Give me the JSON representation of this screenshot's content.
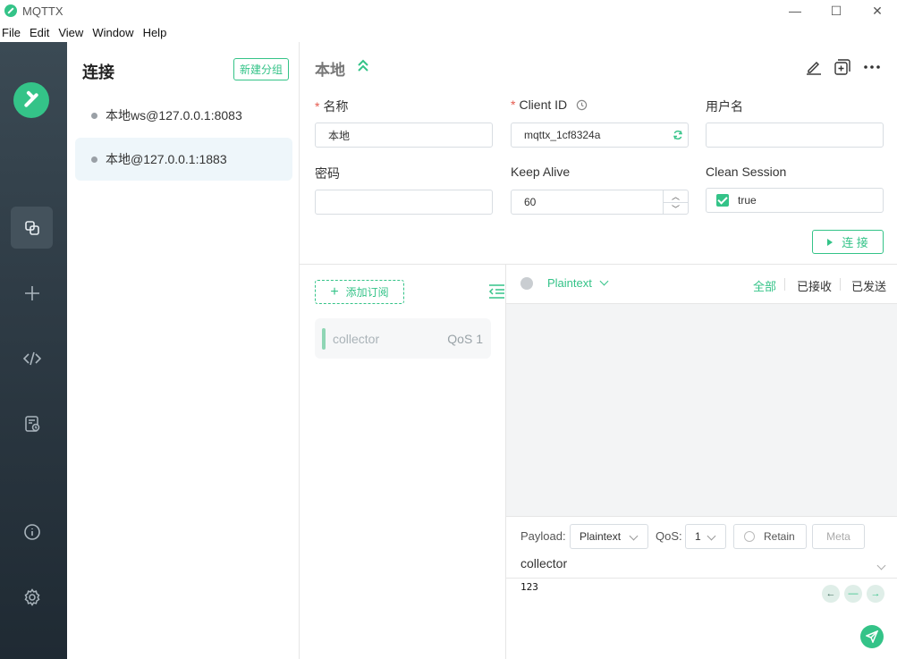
{
  "window": {
    "title": "MQTTX",
    "minimize": "—",
    "maximize": "☐",
    "close": "✕"
  },
  "menu": [
    "File",
    "Edit",
    "View",
    "Window",
    "Help"
  ],
  "rail": {
    "icons": [
      "connections-icon",
      "plus-icon",
      "script-icon",
      "log-icon",
      "info-icon",
      "settings-icon"
    ],
    "active": "connections-icon"
  },
  "connections": {
    "heading": "连接",
    "new_group": "新建分组",
    "items": [
      {
        "label": "本地ws@127.0.0.1:8083",
        "active": false
      },
      {
        "label": "本地@127.0.0.1:1883",
        "active": true
      }
    ]
  },
  "main": {
    "title": "本地",
    "form": {
      "name_label": "名称",
      "name_value": "本地",
      "client_id_label": "Client ID",
      "client_id_value": "mqttx_1cf8324a",
      "username_label": "用户名",
      "username_value": "",
      "password_label": "密码",
      "password_value": "",
      "keepalive_label": "Keep Alive",
      "keepalive_value": "60",
      "clean_session_label": "Clean Session",
      "clean_session_value": "true",
      "required_mark": "*"
    },
    "connect_button": "连 接"
  },
  "subscriptions": {
    "add_button": "添加订阅",
    "items": [
      {
        "topic": "collector",
        "qos": "QoS 1",
        "color": "#8fd6b5"
      }
    ]
  },
  "messages": {
    "format": "Plaintext",
    "filters": [
      "全部",
      "已接收",
      "已发送"
    ],
    "active_filter": "全部"
  },
  "publish": {
    "payload_label": "Payload:",
    "payload_format": "Plaintext",
    "qos_label": "QoS:",
    "qos_value": "1",
    "retain_label": "Retain",
    "meta_label": "Meta",
    "topic": "collector",
    "payload": "123"
  },
  "colors": {
    "accent": "#34c388",
    "rail": "#2f3c46"
  }
}
